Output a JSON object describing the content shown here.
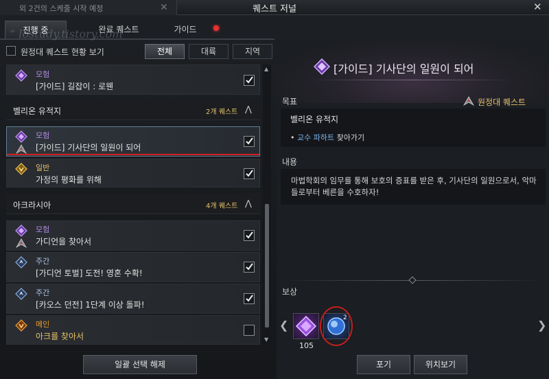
{
  "window": {
    "bg_tab_title": "외 2건의 스케줄 시작 예정",
    "title": "퀘스트 저널"
  },
  "watermark": "“ lostudy.tistory.com ”",
  "tabs": [
    {
      "label": "진행 중",
      "active": true
    },
    {
      "label": "완료 퀘스트",
      "active": false
    },
    {
      "label": "가이드",
      "active": false,
      "has_alert": true
    }
  ],
  "filter": {
    "expedition_checkbox_label": "원정대 퀘스트 현황 보기",
    "buttons": [
      "전체",
      "대륙",
      "지역"
    ],
    "active": "전체"
  },
  "quest_list": {
    "top_quest": {
      "type": "모험",
      "name": "[가이드] 길잡이 : 로웬",
      "checked": true
    },
    "groups": [
      {
        "name": "벨리온 유적지",
        "count": "2개 퀘스트",
        "quests": [
          {
            "type": "모험",
            "name": "[가이드] 기사단의 일원이 되어",
            "checked": true,
            "selected": true
          },
          {
            "type": "일반",
            "name": "가정의 평화를 위해",
            "checked": true
          }
        ]
      },
      {
        "name": "아크라시아",
        "count": "4개 퀘스트",
        "quests": [
          {
            "type": "모험",
            "name": "가디언을 찾아서",
            "checked": true
          },
          {
            "type": "주간",
            "name": "[가디언 토벌] 도전! 영혼 수확!",
            "checked": true
          },
          {
            "type": "주간",
            "name": "[카오스 던전] 1단계 이상 돌파!",
            "checked": true
          },
          {
            "type": "메인",
            "name": "아크를 찾아서",
            "checked": false
          }
        ]
      }
    ]
  },
  "deselect_all_button": "일괄 선택 해제",
  "detail": {
    "title": "[가이드] 기사단의 일원이 되어",
    "goal_header": "목표",
    "expedition_tag": "원정대 퀘스트",
    "goal_location": "벨리온 유적지",
    "goal_bullet": "•",
    "goal_target": "교수 파하트",
    "goal_action": " 찾아가기",
    "content_header": "내용",
    "content_text": "마법학회의 임무를 통해 보호의 증표를 받은 후, 기사단의 일원으로서, 악마들로부터 베른을 수호하자!",
    "reward_header": "보상",
    "rewards": [
      {
        "icon": "purple-gem-icon",
        "count": "105"
      },
      {
        "icon": "blue-orb-icon",
        "badge": "2"
      }
    ],
    "abandon_button": "포기",
    "locate_button": "위치보기"
  },
  "colors": {
    "accent_gold": "#e6c36a",
    "adventure_purple": "#a46be0",
    "weekly_blue": "#7aa2d8",
    "main_orange": "#e89a2a",
    "highlight_blue": "#7db4e6",
    "annotation_red": "#d21f1f"
  }
}
